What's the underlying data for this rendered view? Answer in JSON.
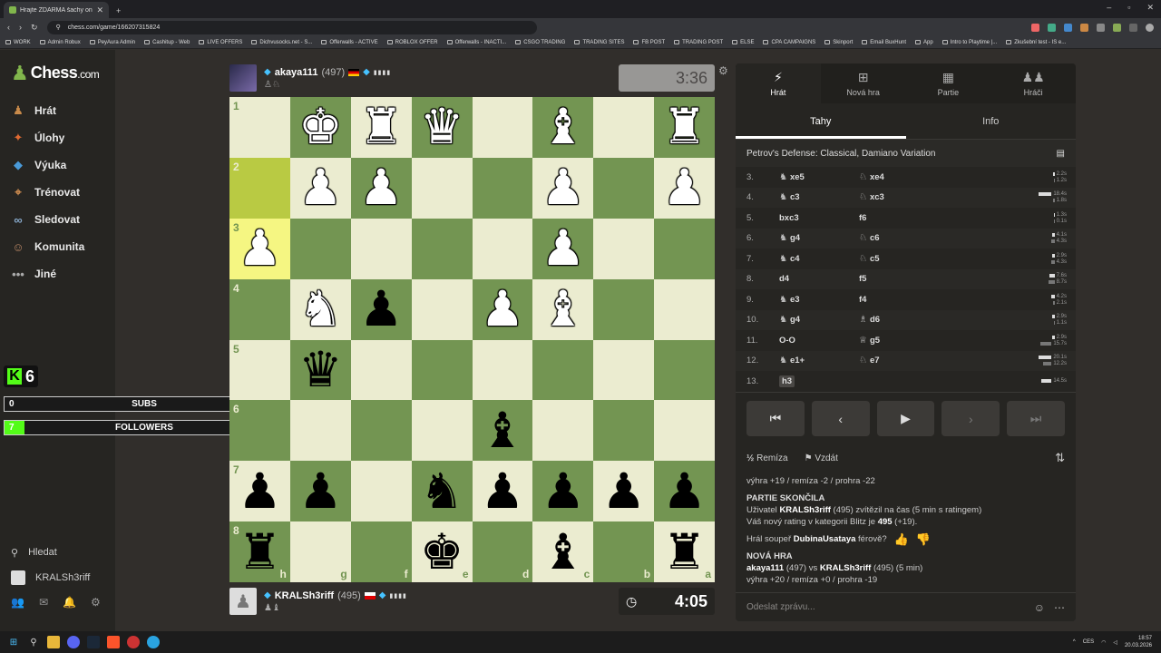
{
  "browser": {
    "tab_title": "Hrajte ZDARMA šachy online",
    "url": "chess.com/game/166207315824",
    "bookmarks": [
      "WORK",
      "Admin Robux",
      "PeyAura Admin",
      "Cashitup - Web",
      "LIVE OFFERS",
      "Dichvusocks.net - S...",
      "Offerwalls - ACTIVE",
      "ROBLOX OFFER",
      "Offerwalls - INACTI...",
      "CSGO TRADING",
      "TRADING SITES",
      "FB POST",
      "TRADING POST",
      "ELSE",
      "CPA CAMPAIGNS",
      "Skinport",
      "Email BuxHunt",
      "App",
      "Intro to Playtime |...",
      "Zkušební test - IS e..."
    ]
  },
  "sidebar": {
    "logo_main": "Chess",
    "logo_suffix": ".com",
    "items": [
      {
        "label": "Hrát",
        "icon": "play-piece-icon"
      },
      {
        "label": "Úlohy",
        "icon": "puzzle-icon"
      },
      {
        "label": "Výuka",
        "icon": "graduation-cap-icon"
      },
      {
        "label": "Trénovat",
        "icon": "target-icon"
      },
      {
        "label": "Sledovat",
        "icon": "binoculars-icon"
      },
      {
        "label": "Komunita",
        "icon": "people-icon"
      },
      {
        "label": "Jiné",
        "icon": "more-dots-icon"
      }
    ],
    "search_label": "Hledat",
    "username": "KRALSh3riff"
  },
  "overlay": {
    "kick_count": "6",
    "subs": {
      "current": "0",
      "label": "SUBS",
      "goal": "10",
      "fraction": 0.0
    },
    "followers": {
      "current": "7",
      "label": "FOLLOWERS",
      "goal": "100",
      "fraction": 0.07
    }
  },
  "top_player": {
    "name": "akaya111",
    "rating": "(497)",
    "clock": "3:36"
  },
  "bottom_player": {
    "name": "KRALSh3riff",
    "rating": "(495)",
    "clock": "4:05"
  },
  "board": {
    "ranks": [
      "1",
      "2",
      "3",
      "4",
      "5",
      "6",
      "7",
      "8"
    ],
    "files": [
      "h",
      "g",
      "f",
      "e",
      "d",
      "c",
      "b",
      "a"
    ],
    "rows": [
      [
        "",
        "wK",
        "wR",
        "wQ",
        "",
        "wB",
        "",
        "wR"
      ],
      [
        "",
        "wP",
        "wP",
        "",
        "",
        "wP",
        "",
        "wP"
      ],
      [
        "wP",
        "",
        "",
        "",
        "",
        "wP",
        "",
        ""
      ],
      [
        "",
        "wN",
        "bP",
        "",
        "wP",
        "wB",
        "",
        ""
      ],
      [
        "",
        "bQ",
        "",
        "",
        "",
        "",
        "",
        ""
      ],
      [
        "",
        "",
        "",
        "",
        "bB",
        "",
        "",
        ""
      ],
      [
        "bP",
        "bP",
        "",
        "bN",
        "bP",
        "bP",
        "bP",
        "bP"
      ],
      [
        "bR",
        "",
        "",
        "bK",
        "",
        "bB",
        "",
        "bR"
      ]
    ],
    "highlight": [
      [
        1,
        0
      ],
      [
        2,
        0
      ]
    ]
  },
  "panel": {
    "tabs": [
      {
        "label": "Hrát",
        "icon": "lightning-icon"
      },
      {
        "label": "Nová hra",
        "icon": "plus-square-icon"
      },
      {
        "label": "Partie",
        "icon": "board-icon"
      },
      {
        "label": "Hráči",
        "icon": "players-icon"
      }
    ],
    "subtabs": [
      "Tahy",
      "Info"
    ],
    "opening": "Petrov's Defense: Classical, Damiano Variation",
    "moves": [
      {
        "n": "3.",
        "w": "xe5",
        "wp": "♞",
        "b": "xe4",
        "bp": "♘",
        "t1": "2.2s",
        "t2": "1.2s",
        "f1": 0.12,
        "f2": 0.06
      },
      {
        "n": "4.",
        "w": "c3",
        "wp": "♞",
        "b": "xc3",
        "bp": "♘",
        "t1": "18.4s",
        "t2": "1.8s",
        "f1": 1.0,
        "f2": 0.1
      },
      {
        "n": "5.",
        "w": "bxc3",
        "wp": "",
        "b": "f6",
        "bp": "",
        "t1": "1.3s",
        "t2": "0.1s",
        "f1": 0.07,
        "f2": 0.01
      },
      {
        "n": "6.",
        "w": "g4",
        "wp": "♞",
        "b": "c6",
        "bp": "♘",
        "t1": "4.1s",
        "t2": "4.3s",
        "f1": 0.22,
        "f2": 0.23
      },
      {
        "n": "7.",
        "w": "c4",
        "wp": "♞",
        "b": "c5",
        "bp": "♘",
        "t1": "2.9s",
        "t2": "4.3s",
        "f1": 0.16,
        "f2": 0.23
      },
      {
        "n": "8.",
        "w": "d4",
        "wp": "",
        "b": "f5",
        "bp": "",
        "t1": "7.6s",
        "t2": "8.7s",
        "f1": 0.41,
        "f2": 0.47
      },
      {
        "n": "9.",
        "w": "e3",
        "wp": "♞",
        "b": "f4",
        "bp": "",
        "t1": "4.2s",
        "t2": "2.1s",
        "f1": 0.23,
        "f2": 0.11
      },
      {
        "n": "10.",
        "w": "g4",
        "wp": "♞",
        "b": "d6",
        "bp": "♗",
        "t1": "2.9s",
        "t2": "1.1s",
        "f1": 0.16,
        "f2": 0.06
      },
      {
        "n": "11.",
        "w": "O-O",
        "wp": "",
        "b": "g5",
        "bp": "♕",
        "t1": "2.9s",
        "t2": "15.7s",
        "f1": 0.16,
        "f2": 0.85
      },
      {
        "n": "12.",
        "w": "e1+",
        "wp": "♞",
        "b": "e7",
        "bp": "♘",
        "t1": "20.1s",
        "t2": "12.2s",
        "f1": 1.0,
        "f2": 0.66
      },
      {
        "n": "13.",
        "w": "h3",
        "wp": "",
        "b": "",
        "bp": "",
        "t1": "14.5s",
        "t2": "",
        "f1": 0.79,
        "f2": 0,
        "current": true
      }
    ],
    "actions": {
      "draw": "Remíza",
      "resign": "Vzdát"
    },
    "chat": {
      "result_line": "výhra +19 / remíza -2 / prohra -22",
      "game_over_title": "PARTIE SKONČILA",
      "over_line1_pre": "Uživatel ",
      "over_line1_name": "KRALSh3riff",
      "over_line1_post": " (495) zvítězil na čas (5 min s ratingem)",
      "over_line2_pre": "Váš nový rating v kategorii Blitz je ",
      "over_line2_rating": "495",
      "over_line2_post": " (+19).",
      "fair_pre": "Hrál soupeř ",
      "fair_name": "DubinaUsataya",
      "fair_post": " férově?",
      "new_game_title": "NOVÁ HRA",
      "new_game_p1": "akaya111",
      "new_game_mid": " (497) vs ",
      "new_game_p2": "KRALSh3riff",
      "new_game_post": " (495) (5 min)",
      "new_game_result": "výhra +20 / remíza +0 / prohra -19",
      "input_placeholder": "Odeslat zprávu..."
    }
  },
  "taskbar": {
    "lang": "CES",
    "time": "18:57",
    "date": "20.03.2026"
  }
}
